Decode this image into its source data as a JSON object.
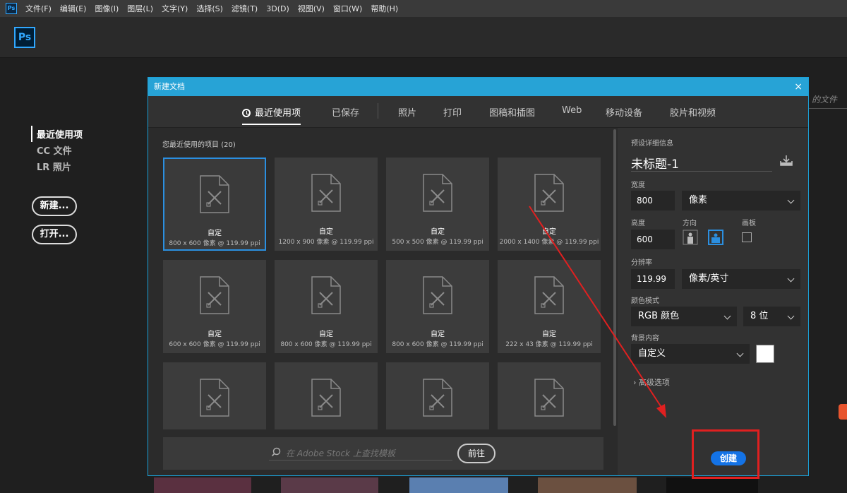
{
  "menubar": {
    "app_icon": "Ps",
    "items": [
      "文件(F)",
      "编辑(E)",
      "图像(I)",
      "图层(L)",
      "文字(Y)",
      "选择(S)",
      "滤镜(T)",
      "3D(D)",
      "视图(V)",
      "窗口(W)",
      "帮助(H)"
    ]
  },
  "home": {
    "logo": "Ps",
    "nav": [
      "最近使用项",
      "CC 文件",
      "LR 照片"
    ],
    "new_button": "新建...",
    "open_button": "打开...",
    "bg_text": "的文件"
  },
  "dialog": {
    "title": "新建文档",
    "close": "×",
    "tabs": [
      "最近使用项",
      "已保存",
      "照片",
      "打印",
      "图稿和插图",
      "Web",
      "移动设备",
      "胶片和视频"
    ],
    "active_tab": "最近使用项",
    "recent_title": "您最近使用的项目",
    "recent_count": "(20)",
    "presets": [
      {
        "name": "自定",
        "size": "800 x 600 像素 @ 119.99 ppi"
      },
      {
        "name": "自定",
        "size": "1200 x 900 像素 @ 119.99 ppi"
      },
      {
        "name": "自定",
        "size": "500 x 500 像素 @ 119.99 ppi"
      },
      {
        "name": "自定",
        "size": "2000 x 1400 像素 @ 119.99 ppi"
      },
      {
        "name": "自定",
        "size": "600 x 600 像素 @ 119.99 ppi"
      },
      {
        "name": "自定",
        "size": "800 x 600 像素 @ 119.99 ppi"
      },
      {
        "name": "自定",
        "size": "800 x 600 像素 @ 119.99 ppi"
      },
      {
        "name": "自定",
        "size": "222 x 43 像素 @ 119.99 ppi"
      },
      {
        "name": "",
        "size": ""
      },
      {
        "name": "",
        "size": ""
      },
      {
        "name": "",
        "size": ""
      },
      {
        "name": "",
        "size": ""
      }
    ],
    "stock_placeholder": "在 Adobe Stock 上查找模板",
    "go_button": "前往",
    "details": {
      "header": "预设详细信息",
      "doc_name": "未标题-1",
      "width_label": "宽度",
      "width_value": "800",
      "width_unit": "像素",
      "height_label": "高度",
      "height_value": "600",
      "orientation_label": "方向",
      "artboard_label": "画板",
      "resolution_label": "分辨率",
      "resolution_value": "119.99",
      "resolution_unit": "像素/英寸",
      "color_mode_label": "颜色模式",
      "color_mode": "RGB 颜色",
      "bit_depth": "8 位",
      "background_label": "背景内容",
      "background": "自定义",
      "background_color": "#ffffff",
      "advanced": "高级选项",
      "create_button": "创建"
    }
  },
  "colors": {
    "accent": "#31a8ff",
    "titlebar": "#27a3d6",
    "create": "#1473e6",
    "annotation": "#e02020"
  }
}
